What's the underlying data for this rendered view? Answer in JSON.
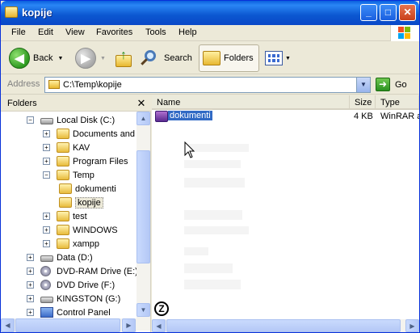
{
  "window": {
    "title": "kopije"
  },
  "title_buttons": {
    "minimize": "_",
    "maximize": "□",
    "close": "✕"
  },
  "menu": [
    "File",
    "Edit",
    "View",
    "Favorites",
    "Tools",
    "Help"
  ],
  "toolbar": {
    "back": "Back",
    "search": "Search",
    "folders": "Folders"
  },
  "address": {
    "label": "Address",
    "path": "C:\\Temp\\kopije",
    "go": "Go"
  },
  "folders_pane": {
    "title": "Folders",
    "items": [
      {
        "label": "Local Disk (C:)",
        "expander": "−",
        "icon": "drive-icon"
      },
      {
        "label": "Documents and S",
        "expander": "+",
        "icon": "folder-icon"
      },
      {
        "label": "KAV",
        "expander": "+",
        "icon": "folder-icon"
      },
      {
        "label": "Program Files",
        "expander": "+",
        "icon": "folder-icon"
      },
      {
        "label": "Temp",
        "expander": "−",
        "icon": "folder-icon"
      },
      {
        "label": "dokumenti",
        "expander": "",
        "icon": "folder-icon"
      },
      {
        "label": "kopije",
        "expander": "",
        "icon": "folder-icon",
        "selected": true
      },
      {
        "label": "test",
        "expander": "+",
        "icon": "folder-icon"
      },
      {
        "label": "WINDOWS",
        "expander": "+",
        "icon": "folder-icon"
      },
      {
        "label": "xampp",
        "expander": "+",
        "icon": "folder-icon"
      },
      {
        "label": "Data (D:)",
        "expander": "+",
        "icon": "drive-icon"
      },
      {
        "label": "DVD-RAM Drive (E:)",
        "expander": "+",
        "icon": "disc-icon"
      },
      {
        "label": "DVD Drive (F:)",
        "expander": "+",
        "icon": "disc-icon"
      },
      {
        "label": "KINGSTON (G:)",
        "expander": "+",
        "icon": "drive-icon"
      },
      {
        "label": "Control Panel",
        "expander": "+",
        "icon": "control-panel-icon"
      }
    ]
  },
  "file_list": {
    "columns": [
      "Name",
      "Size",
      "Type"
    ],
    "rows": [
      {
        "name": "dokumenti",
        "size": "4 KB",
        "type": "WinRAR a"
      }
    ]
  },
  "colors": {
    "title_blue": "#0a5fde",
    "selection": "#316ac5"
  }
}
